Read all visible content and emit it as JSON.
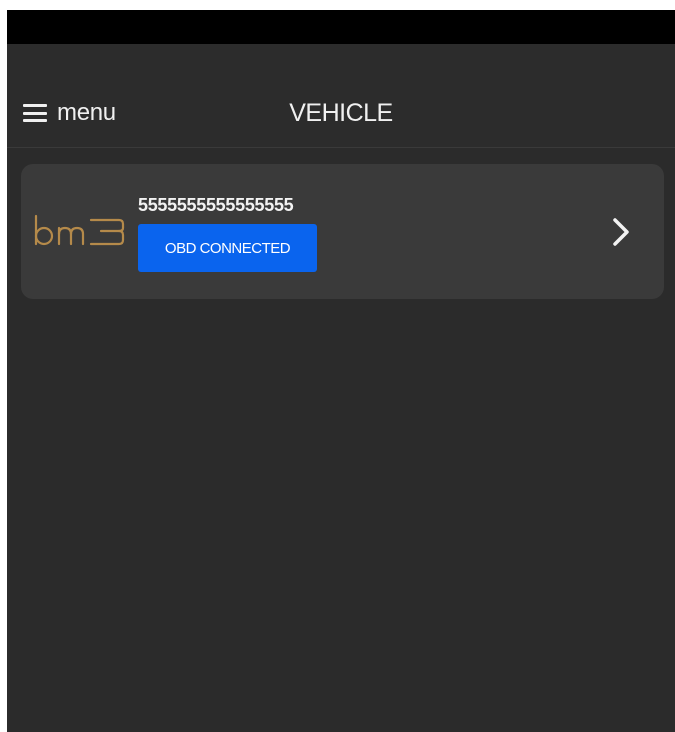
{
  "status_bar": {},
  "nav": {
    "menu_label": "menu",
    "title": "VEHICLE"
  },
  "vehicles": [
    {
      "brand": "bm3",
      "id": "5555555555555555",
      "status": "OBD CONNECTED",
      "status_color": "#0a64ee",
      "logo_color": "#b58a4a",
      "action_icon": "chevron-right-icon"
    }
  ],
  "colors": {
    "background": "#2b2b2b",
    "card": "#3a3a3a",
    "status_bar": "#000000"
  }
}
